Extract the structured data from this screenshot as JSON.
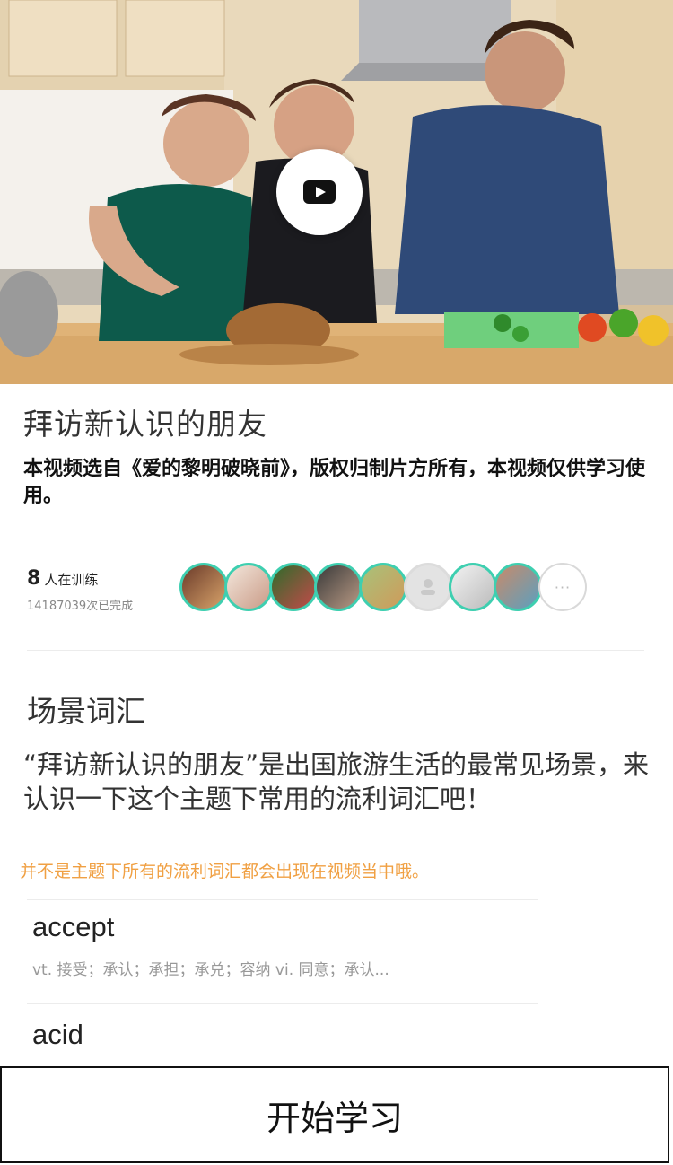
{
  "video": {
    "thumbnail_icon": "play-icon"
  },
  "title": "拜访新认识的朋友",
  "copyright": "本视频选自《爱的黎明破晓前》，版权归制片方所有，本视频仅供学习使用。",
  "training": {
    "count": "8",
    "count_label": "人在训练",
    "completed": "14187039次已完成",
    "more_label": "···",
    "accent_color": "#3ecfb0"
  },
  "vocab": {
    "section_title": "场景词汇",
    "description": "“拜访新认识的朋友”是出国旅游生活的最常见场景，来认识一下这个主题下常用的流利词汇吧！",
    "notice": "并不是主题下所有的流利词汇都会出现在视频当中哦。",
    "notice_color": "#f0a043",
    "words": [
      {
        "word": "accept",
        "definition": "vt. 接受；承认；承担；承兑；容纳 vi. 同意；承认..."
      },
      {
        "word": "acid",
        "definition": ""
      }
    ]
  },
  "cta": {
    "label": "开始学习"
  }
}
